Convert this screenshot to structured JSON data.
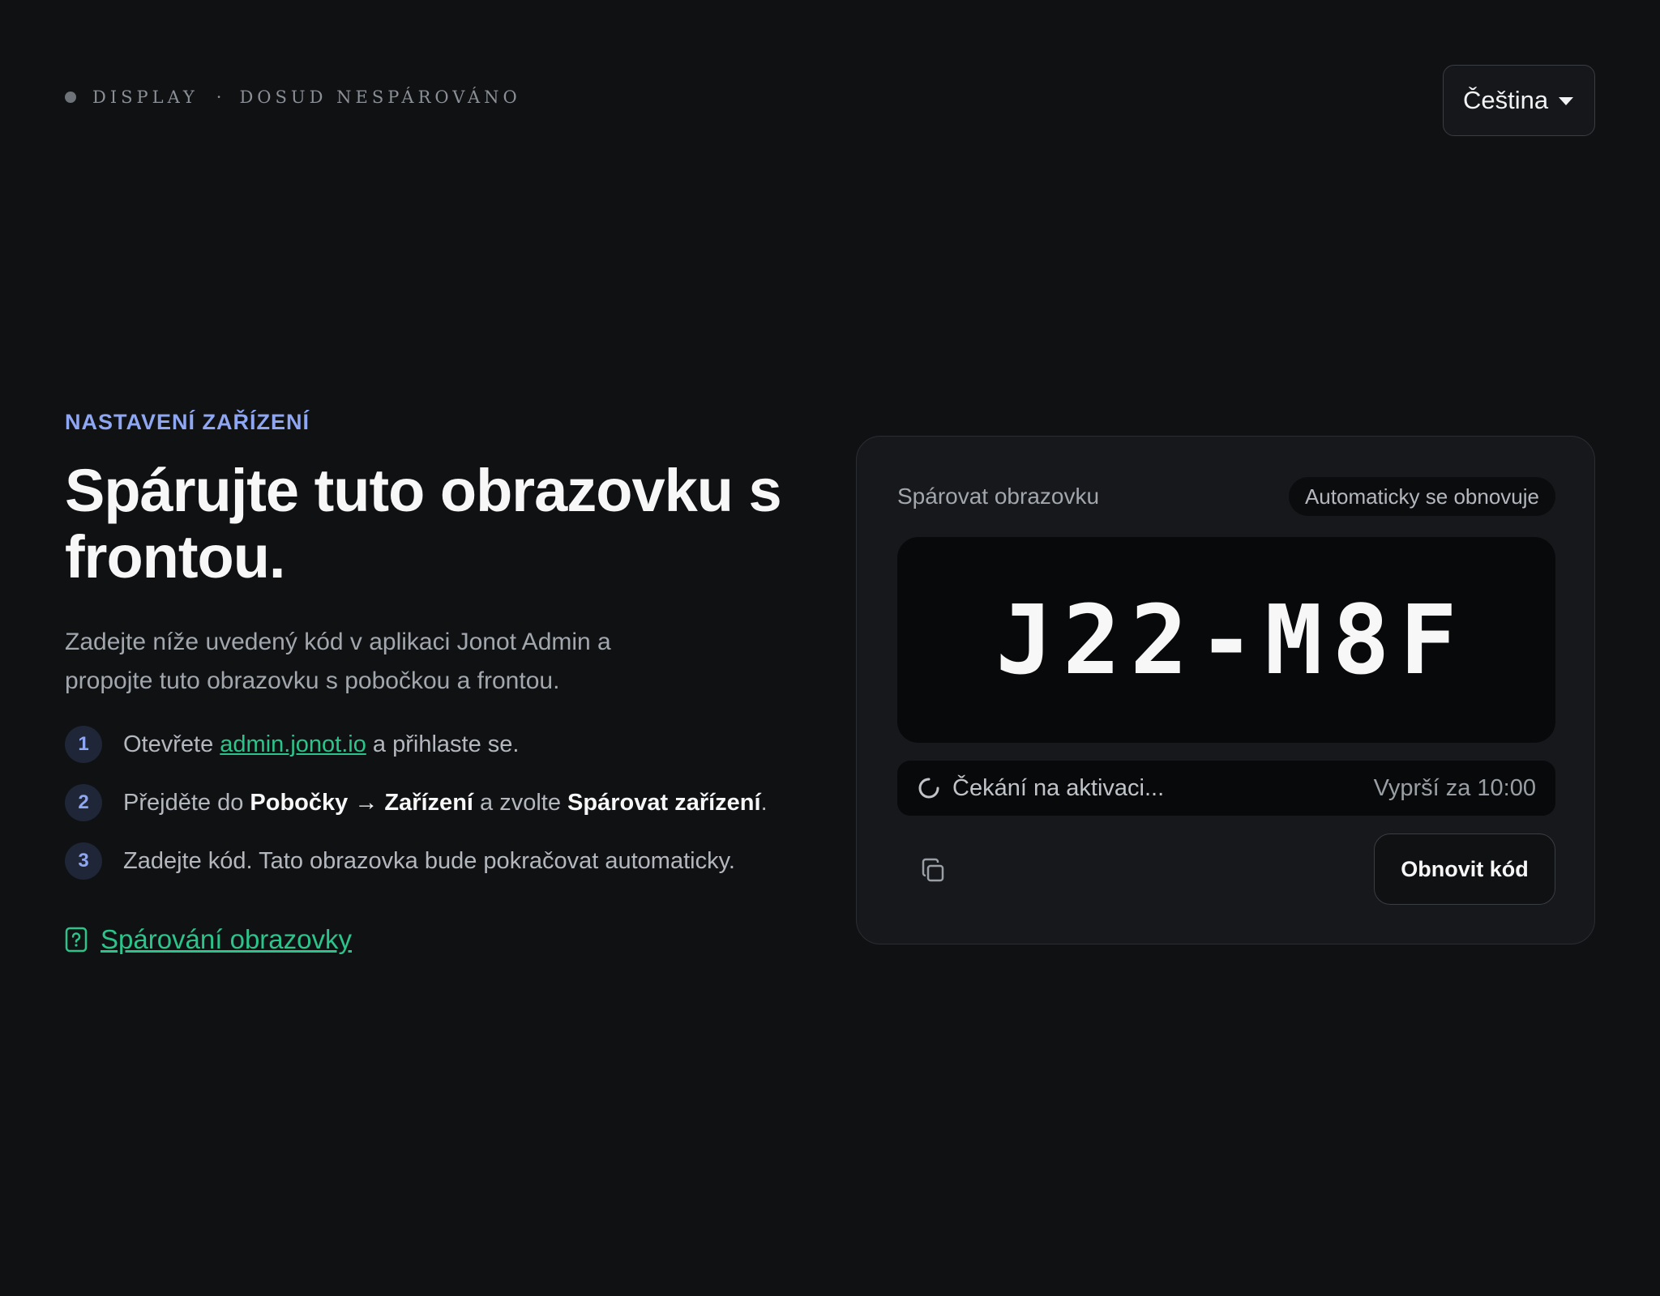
{
  "header": {
    "device_label": "DISPLAY",
    "separator": "·",
    "pairing_status": "DOSUD NESPÁROVÁNO",
    "language": "Čeština"
  },
  "intro": {
    "eyebrow": "NASTAVENÍ ZAŘÍZENÍ",
    "headline": "Spárujte tuto obrazovku s frontou.",
    "description": "Zadejte níže uvedený kód v aplikaci Jonot Admin a propojte tuto obrazovku s pobočkou a frontou."
  },
  "steps": [
    {
      "number": "1",
      "prefix": "Otevřete ",
      "link": "admin.jonot.io",
      "suffix": " a přihlaste se."
    },
    {
      "number": "2",
      "prefix": "Přejděte do ",
      "bold1": "Pobočky → Zařízení",
      "middle": " a zvolte ",
      "bold2": "Spárovat zařízení",
      "suffix": "."
    },
    {
      "number": "3",
      "text": "Zadejte kód. Tato obrazovka bude pokračovat automaticky."
    }
  ],
  "help_link": {
    "label": "Spárování obrazovky",
    "icon": "help-document-icon"
  },
  "pairing_card": {
    "title": "Spárovat obrazovku",
    "badge": "Automaticky se obnovuje",
    "code": "J22-M8F",
    "waiting_text": "Čekání na aktivaci...",
    "expires_text": "Vyprší za 10:00",
    "copy_icon": "copy-icon",
    "refresh_label": "Obnovit kód"
  },
  "colors": {
    "background": "#0f1113",
    "card": "#16181b",
    "accent_blue": "#8fa6f2",
    "accent_green": "#2bc48a",
    "text_primary": "#f7f7f8",
    "text_muted": "#a2a6ad"
  }
}
